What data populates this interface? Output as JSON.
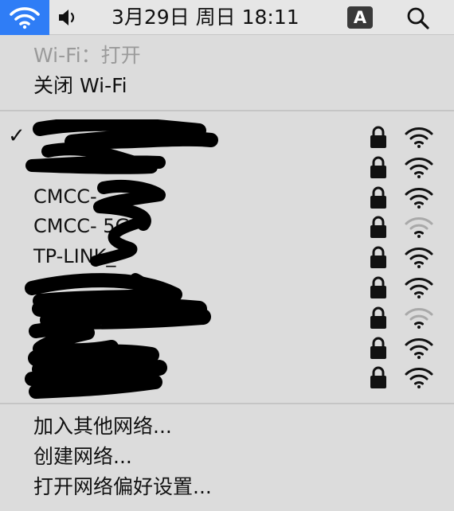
{
  "menubar": {
    "clock": "3月29日 周日 18:11",
    "input_source": "A",
    "icons": [
      "wifi-icon",
      "volume-icon",
      "search-icon"
    ],
    "wifi_highlight_color": "#2f7df6"
  },
  "wifi_menu": {
    "status": "Wi-Fi：打开",
    "turn_off": "关闭 Wi-Fi",
    "checkmark": "✓",
    "networks": [
      {
        "name": "",
        "connected": true,
        "locked": true,
        "signal": 3
      },
      {
        "name": "",
        "connected": false,
        "locked": true,
        "signal": 3
      },
      {
        "name": "CMCC-",
        "connected": false,
        "locked": true,
        "signal": 3
      },
      {
        "name": "CMCC-        5G",
        "connected": false,
        "locked": true,
        "signal": 1
      },
      {
        "name": "TP-LINK_",
        "connected": false,
        "locked": true,
        "signal": 3
      },
      {
        "name": "",
        "connected": false,
        "locked": true,
        "signal": 3
      },
      {
        "name": "",
        "connected": false,
        "locked": true,
        "signal": 1
      },
      {
        "name": "",
        "connected": false,
        "locked": true,
        "signal": 3
      },
      {
        "name": "",
        "connected": false,
        "locked": true,
        "signal": 3
      }
    ],
    "join_other": "加入其他网络...",
    "create_network": "创建网络...",
    "open_prefs": "打开网络偏好设置..."
  }
}
